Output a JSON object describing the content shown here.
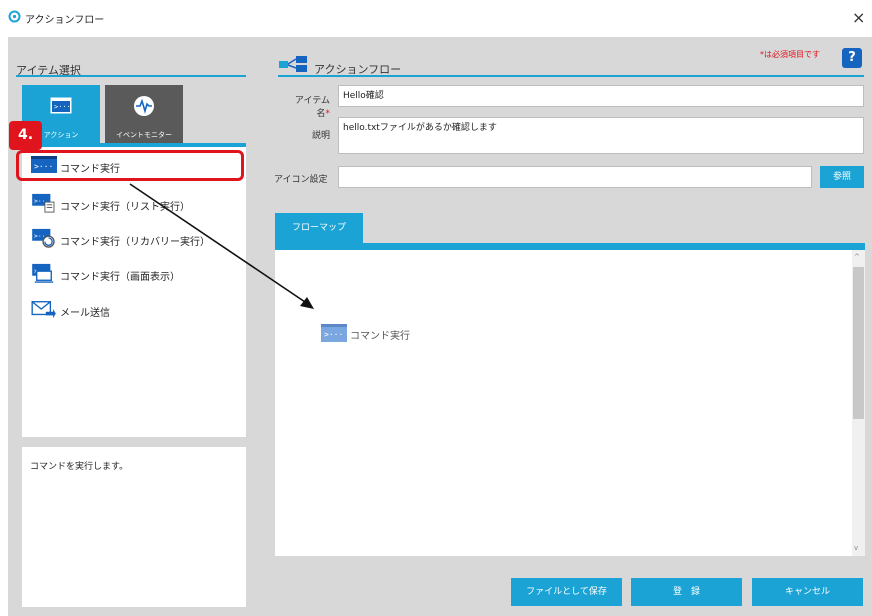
{
  "window": {
    "title": "アクションフロー",
    "close_glyph": "×"
  },
  "left": {
    "section_title": "アイテム選択",
    "tabs": [
      {
        "label": "アクション",
        "icon": "command-icon",
        "selected": true
      },
      {
        "label": "イベントモニター",
        "icon": "pulse-icon",
        "selected": false
      }
    ],
    "items": [
      {
        "label": "コマンド実行",
        "icon": "command-icon",
        "selected": true
      },
      {
        "label": "コマンド実行（リスト実行）",
        "icon": "command-list-icon"
      },
      {
        "label": "コマンド実行（リカバリー実行）",
        "icon": "command-recovery-icon"
      },
      {
        "label": "コマンド実行（画面表示）",
        "icon": "command-screen-icon"
      },
      {
        "label": "メール送信",
        "icon": "mail-send-icon"
      }
    ],
    "description": "コマンドを実行します。"
  },
  "annotation": {
    "step": "4.",
    "highlight_color": "#e0141c"
  },
  "right": {
    "title": "アクションフロー",
    "required_note": "*は必須項目です",
    "help_label": "?",
    "fields": {
      "item_name": {
        "label": "アイテム名",
        "required_mark": "*",
        "value": "Hello確認"
      },
      "description": {
        "label": "説明",
        "value": "hello.txtファイルがあるか確認します"
      },
      "icon": {
        "label": "アイコン設定",
        "value": "",
        "browse_label": "参照"
      }
    },
    "flowmap": {
      "tab_label": "フローマップ",
      "node": {
        "label": "コマンド実行",
        "icon": "command-icon"
      },
      "scroll_up": "^",
      "scroll_down": "v"
    },
    "buttons": {
      "save_file": "ファイルとして保存",
      "register": "登　録",
      "cancel": "キャンセル"
    }
  },
  "colors": {
    "accent": "#1aa3d4",
    "annotation_red": "#e0141c",
    "panel_gray": "#d8d8d8",
    "help_blue": "#1565c0"
  }
}
